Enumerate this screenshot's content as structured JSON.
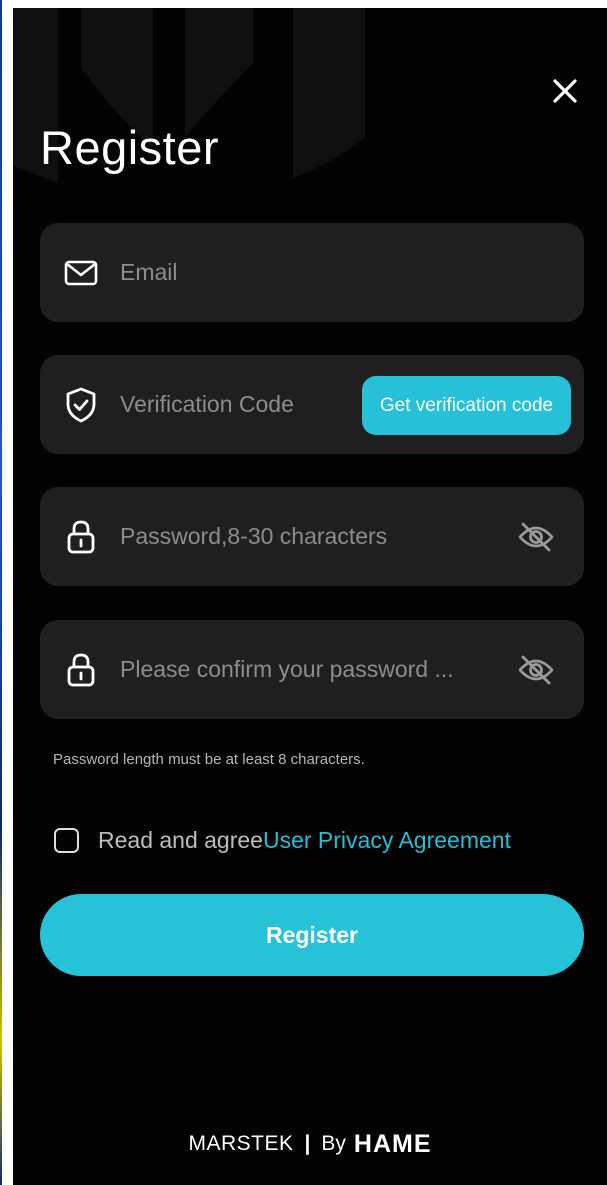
{
  "header": {
    "title": "Register",
    "close_icon": "close-icon"
  },
  "form": {
    "email": {
      "placeholder": "Email",
      "icon": "mail-icon"
    },
    "code": {
      "placeholder": "Verification Code",
      "icon": "shield-check-icon",
      "button_label": "Get verification code"
    },
    "password": {
      "placeholder": "Password,8-30 characters",
      "icon": "lock-icon",
      "toggle_icon": "eye-off-icon"
    },
    "confirm": {
      "placeholder": "Please confirm your password ...",
      "icon": "lock-icon",
      "toggle_icon": "eye-off-icon"
    },
    "hint": "Password length must be at least 8 characters."
  },
  "agreement": {
    "checked": false,
    "text": "Read and agree",
    "link": "User Privacy Agreement"
  },
  "register_button": "Register",
  "footer": {
    "brand": "MARSTEK",
    "separator": "|",
    "by": "By",
    "partner": "HAME"
  },
  "colors": {
    "background": "#030303",
    "field": "#1f1f1f",
    "accent": "#26c1d8",
    "placeholder": "#8d8d8d",
    "text": "#ffffff"
  }
}
